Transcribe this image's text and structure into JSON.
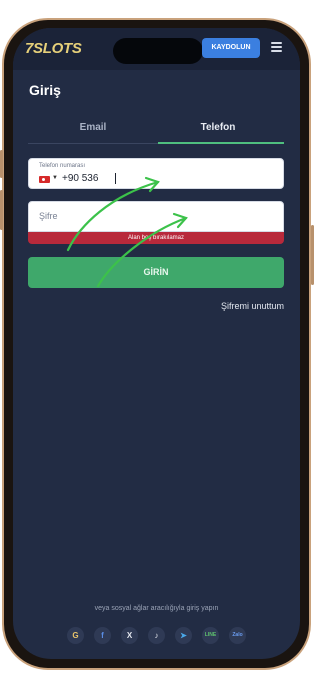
{
  "header": {
    "logo": "7SLOTS",
    "register_label": "KAYDOLUN"
  },
  "page": {
    "title": "Giriş"
  },
  "tabs": [
    {
      "label": "Email"
    },
    {
      "label": "Telefon"
    }
  ],
  "phone_field": {
    "label": "Telefon numarası",
    "value": "+90 536"
  },
  "password_field": {
    "placeholder": "Şifre"
  },
  "error": {
    "message": "Alan boş bırakılamaz"
  },
  "login_button": {
    "label": "GİRİN"
  },
  "forgot_link": "Şifremi unuttum",
  "social": {
    "text": "veya sosyal ağlar aracılığıyla giriş yapın",
    "icons": [
      "google-icon",
      "facebook-icon",
      "x-icon",
      "tiktok-icon",
      "telegram-icon",
      "line-icon",
      "zalo-icon"
    ],
    "glyphs": [
      "G",
      "f",
      "X",
      "♪",
      "➤",
      "LINE",
      "Zalo"
    ]
  },
  "colors": {
    "accent_green": "#3fa86b",
    "register_blue": "#3b7fe0",
    "error_red": "#b8293b",
    "background": "#222c44"
  }
}
